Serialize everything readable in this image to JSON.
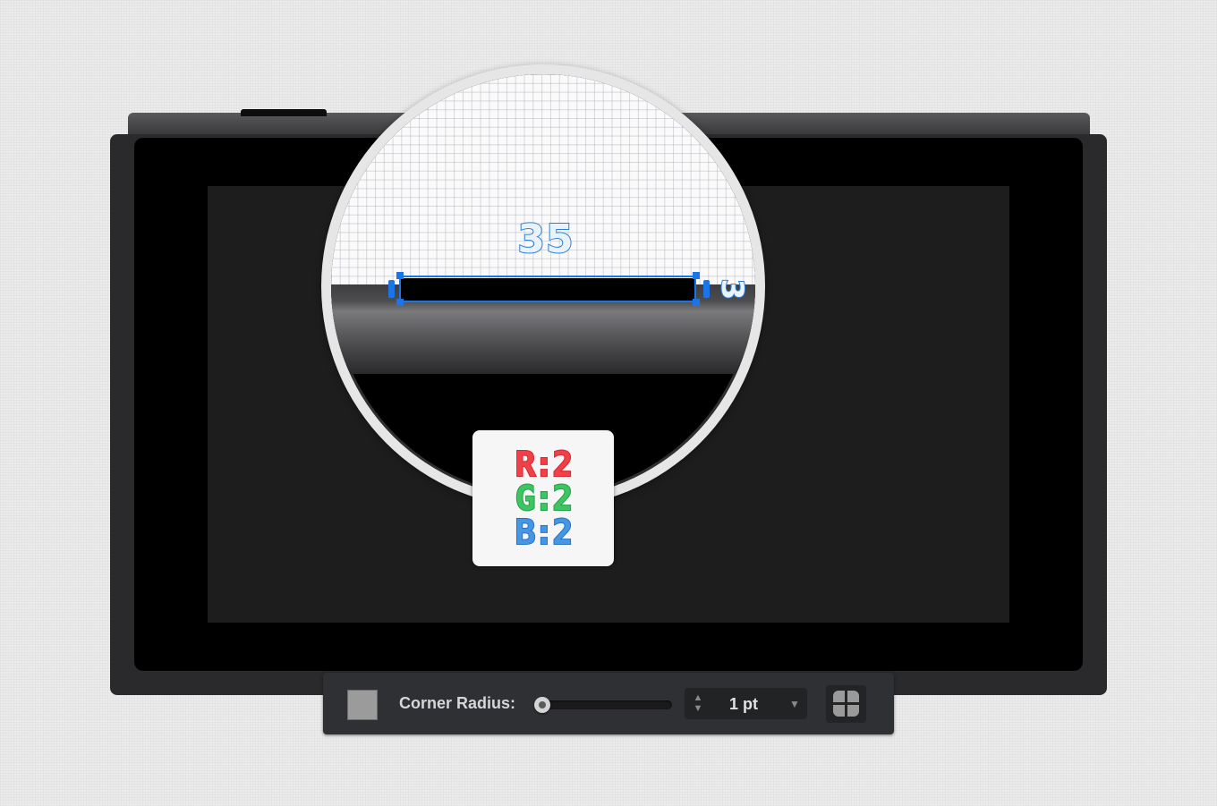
{
  "magnifier": {
    "width_label": "35",
    "height_label": "3"
  },
  "color_card": {
    "r": "R:2",
    "g": "G:2",
    "b": "B:2"
  },
  "inspector": {
    "corner_radius_label": "Corner Radius:",
    "corner_radius_value": "1 pt",
    "slider_fraction": 0.0,
    "swatch_color": "#9b9b9b",
    "stepper_arrows": "▲▼",
    "dropdown_arrow": "▼",
    "corner_icon": "corners-icon"
  },
  "colors": {
    "selection": "#1b74e8",
    "red": "#d9262f",
    "green": "#24a148",
    "blue": "#2673c9"
  }
}
